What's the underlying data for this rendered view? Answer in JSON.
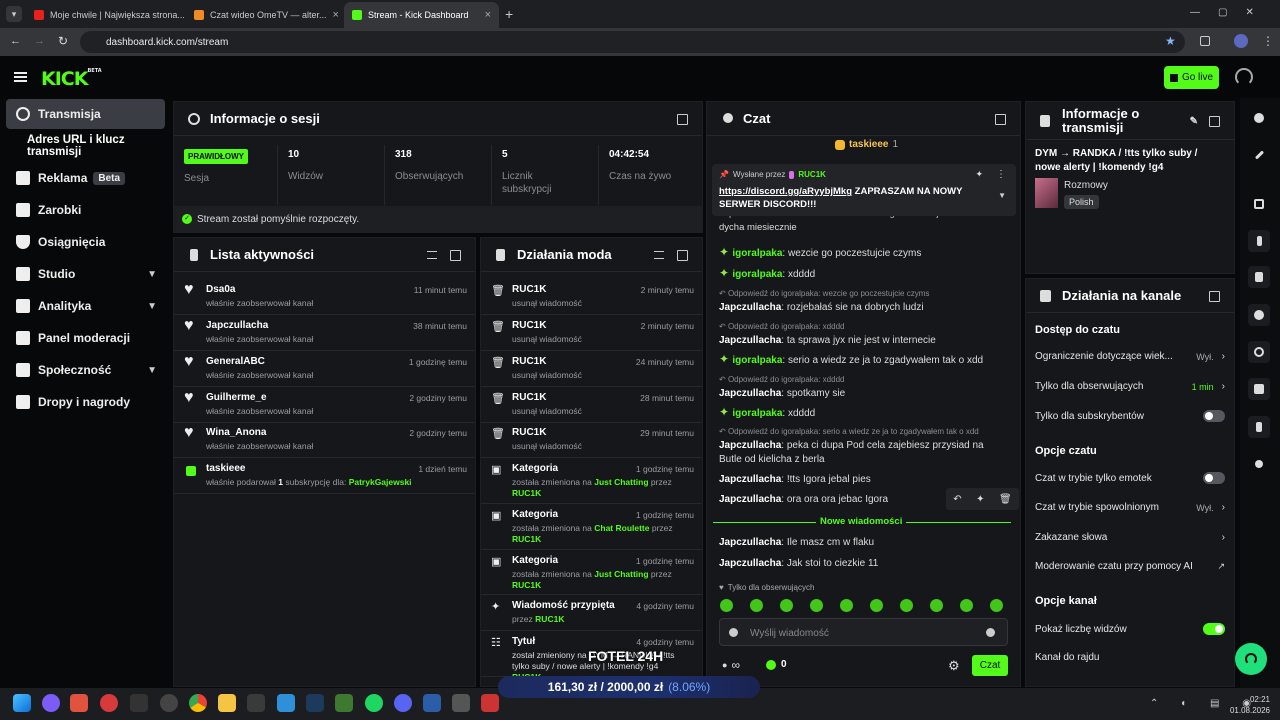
{
  "browser": {
    "tabs": [
      {
        "title": "Moje chwile | Największa strona..."
      },
      {
        "title": "Czat wideo OmeTV — alter..."
      },
      {
        "title": "Stream - Kick Dashboard"
      }
    ],
    "url": "dashboard.kick.com/stream"
  },
  "header": {
    "logo": "KICK",
    "logo_sup": "BETA",
    "go_live": "Go live"
  },
  "nav": [
    {
      "label": "Transmisja"
    },
    {
      "label": "Adres URL i klucz transmisji"
    },
    {
      "label": "Reklama",
      "badge": "Beta"
    },
    {
      "label": "Zarobki"
    },
    {
      "label": "Osiągnięcia"
    },
    {
      "label": "Studio"
    },
    {
      "label": "Analityka"
    },
    {
      "label": "Panel moderacji"
    },
    {
      "label": "Społeczność"
    },
    {
      "label": "Dropy i nagrody"
    }
  ],
  "session": {
    "title": "Informacje o sesji",
    "status_badge": "PRAWIDŁOWY",
    "status_label": "Sesja",
    "stats": [
      {
        "value": "10",
        "label": "Widzów"
      },
      {
        "value": "318",
        "label": "Obserwujących"
      },
      {
        "value": "5",
        "label": "Licznik subskrypcji"
      },
      {
        "value": "04:42:54",
        "label": "Czas na żywo"
      }
    ],
    "success": "Stream został pomyślnie rozpoczęty."
  },
  "activity": {
    "title": "Lista aktywności",
    "items": [
      {
        "name": "Dsa0a",
        "desc": "właśnie zaobserwował kanał",
        "time": "11 minut temu"
      },
      {
        "name": "Japczullacha",
        "desc": "właśnie zaobserwował kanał",
        "time": "38 minut temu"
      },
      {
        "name": "GeneralABC",
        "desc": "właśnie zaobserwował kanał",
        "time": "1 godzinę temu"
      },
      {
        "name": "Guilherme_e",
        "desc": "właśnie zaobserwował kanał",
        "time": "2 godziny temu"
      },
      {
        "name": "Wina_Anona",
        "desc": "właśnie zaobserwował kanał",
        "time": "2 godziny temu"
      },
      {
        "name": "taskieee",
        "desc_pre": "właśnie podarował ",
        "desc_count": "1",
        "desc_mid": " subskrypcję dla: ",
        "desc_user": "PatrykGajewski",
        "time": "1 dzień temu"
      }
    ]
  },
  "modactions": {
    "title": "Działania moda",
    "items": [
      {
        "name": "RUC1K",
        "desc": "usunął wiadomość",
        "time": "2 minuty temu"
      },
      {
        "name": "RUC1K",
        "desc": "usunął wiadomość",
        "time": "2 minuty temu"
      },
      {
        "name": "RUC1K",
        "desc": "usunął wiadomość",
        "time": "24 minuty temu"
      },
      {
        "name": "RUC1K",
        "desc": "usunął wiadomość",
        "time": "28 minut temu"
      },
      {
        "name": "RUC1K",
        "desc": "usunął wiadomość",
        "time": "29 minut temu"
      },
      {
        "name": "Kategoria",
        "desc": "została zmieniona na",
        "cat": "Just Chatting",
        "by": "przez",
        "user": "RUC1K",
        "time": "1 godzinę temu"
      },
      {
        "name": "Kategoria",
        "desc": "została zmieniona na",
        "cat": "Chat Roulette",
        "by": "przez",
        "user": "RUC1K",
        "time": "1 godzinę temu"
      },
      {
        "name": "Kategoria",
        "desc": "została zmieniona na",
        "cat": "Just Chatting",
        "by": "przez",
        "user": "RUC1K",
        "time": "1 godzinę temu"
      },
      {
        "name": "Wiadomość przypięta",
        "desc": "przez",
        "user": "RUC1K",
        "time": "4 godziny temu"
      },
      {
        "name": "Tytuł",
        "desc": "został zmieniony na DYM → RANDKA / !tts tylko suby / nowe alerty | !komendy !g4",
        "user": "RUC1K",
        "time": "4 godziny temu"
      }
    ]
  },
  "chat": {
    "title": "Czat",
    "top_user": "taskieee",
    "top_count": "1",
    "pinned_by": "Wysłane przez",
    "pinned_user": "RUC1K",
    "pinned_link": "https://discord.gg/aRyybjMkg",
    "pinned_text": " ZAPRASZAM NA NOWY SERWER DISCORD!!!",
    "partial": "Japczullacha: Kurwo ok follow i zulik i cego skills to jaz taxha",
    "partial2": "dycha miesiecznie",
    "messages": [
      {
        "user": "igoralpaka",
        "green": true,
        "text": "wezcie go poczestujcie czyms"
      },
      {
        "user": "igoralpaka",
        "green": true,
        "text": "xdddd"
      },
      {
        "reply": "Odpowiedź do igoralpaka: wezcie go poczestujcie czyms",
        "user": "Japczullacha",
        "text": "rozjebałaś sie na dobrych ludzi"
      },
      {
        "reply": "Odpowiedź do igoralpaka: xdddd",
        "user": "Japczullacha",
        "text": "ta sprawa jyx nie jest w internecie"
      },
      {
        "user": "igoralpaka",
        "green": true,
        "text": "serio a wiedz ze ja to zgadywałem tak o xdd"
      },
      {
        "reply": "Odpowiedź do igoralpaka: xdddd",
        "user": "Japczullacha",
        "text": "spotkamy sie"
      },
      {
        "user": "igoralpaka",
        "green": true,
        "text": "xdddd"
      },
      {
        "reply": "Odpowiedź do igoralpaka: serio a wiedz ze ja to zgadywałem tak o xdd",
        "user": "Japczullacha",
        "text": "peka ci dupa Pod cela zajebiesz przysiad na Butle od kielicha z berla"
      },
      {
        "user": "Japczullacha",
        "text": "!tts Igora jebal pies"
      },
      {
        "user": "Japczullacha",
        "text": "ora ora ora jebac Igora"
      }
    ],
    "new_divider": "Nowe wiadomości",
    "new_messages": [
      {
        "user": "Japczullacha",
        "text": "Ile masz cm w flaku"
      },
      {
        "user": "Japczullacha",
        "text": "Jak stoi to ciezkie 11"
      }
    ],
    "followers_only": "Tylko dla obserwujących",
    "input_placeholder": "Wyślij wiadomość",
    "viewers": "∞",
    "kicks": "0",
    "send": "Czat"
  },
  "stream_info": {
    "title": "Informacje o transmisji",
    "stream_title": "DYM → RANDKA / !tts tylko suby / nowe alerty | !komendy !g4",
    "category": "Rozmowy",
    "language": "Polish"
  },
  "channel_actions": {
    "title": "Działania na kanale",
    "sections": [
      {
        "title": "Dostęp do czatu"
      },
      {
        "title": "Opcje czatu"
      },
      {
        "title": "Opcje kanał"
      }
    ],
    "rows": [
      {
        "label": "Ograniczenie dotyczące wiek...",
        "value": "Wył."
      },
      {
        "label": "Tylko dla obserwujących",
        "value": "1 min"
      },
      {
        "label": "Tylko dla subskrybentów"
      },
      {
        "label": "Czat w trybie tylko emotek"
      },
      {
        "label": "Czat w trybie spowolnionym",
        "value": "Wył."
      },
      {
        "label": "Zakazane słowa"
      },
      {
        "label": "Moderowanie czatu przy pomocy AI"
      },
      {
        "label": "Pokaż liczbę widzów"
      },
      {
        "label": "Kanał do rajdu"
      }
    ]
  },
  "overlay": {
    "goal_text": "161,30 zł / 2000,00 zł",
    "goal_pct": "(8.06%)",
    "title_overlay": "FOTEL 24H"
  },
  "taskbar": {
    "time": "02:21",
    "date": "01.08.2026"
  },
  "colors": {
    "accent": "#53fc18",
    "panel": "#16171a",
    "background": "#070809"
  }
}
